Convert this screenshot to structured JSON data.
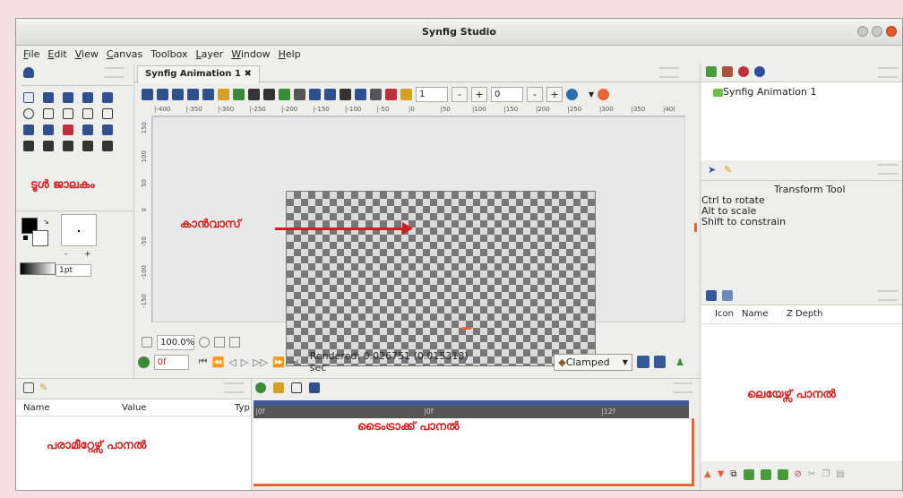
{
  "window": {
    "title": "Synfig Studio"
  },
  "menu": [
    "File",
    "Edit",
    "View",
    "Canvas",
    "Toolbox",
    "Layer",
    "Window",
    "Help"
  ],
  "canvas": {
    "tab_label": "Synfig Animation 1",
    "tab_close": "✖",
    "frame_spin": "1",
    "frame_spin2": "0",
    "ruler_ticks": [
      "-400",
      "-350",
      "-300",
      "-250",
      "-200",
      "-150",
      "-100",
      "-50",
      "0",
      "50",
      "100",
      "150",
      "200",
      "250",
      "300",
      "350",
      "40("
    ],
    "vruler_ticks": [
      "150",
      "100",
      "50",
      "0",
      "-50",
      "-100",
      "-150"
    ],
    "zoom": "100.0%",
    "time_field": "0f",
    "rendered": "Rendered: 0.026751 (0.015318) sec",
    "interpolation": "Clamped"
  },
  "toolbox": {
    "brush_size": "1pt",
    "width_labels": [
      "-",
      "+"
    ]
  },
  "canvas_browser": {
    "item": "Synfig Animation 1"
  },
  "tool_options": {
    "title": "Transform Tool",
    "lines": [
      "Ctrl to rotate",
      "Alt to scale",
      "Shift to constrain"
    ]
  },
  "layers": {
    "columns": [
      "Icon",
      "Name",
      "Z Depth"
    ]
  },
  "params": {
    "columns": [
      "Name",
      "Value",
      "Typ"
    ]
  },
  "timetrack": {
    "marks": [
      "|0f",
      "|12f"
    ]
  },
  "annotations": {
    "tools": "ടൂൾ ജാലകം",
    "canvas": "കാൻവാസ്",
    "layers": "ലെയേഴ്സ് പാനൽ",
    "params": "പരാമീറ്റേഴ്സ് പാനൽ",
    "timetrack": "ടൈംട്രാക്ക് പാനൽ"
  },
  "colors": {
    "accent_red": "#d01e1e",
    "timebar_blue": "#3c5a9a",
    "orange_edge": "#e8633a"
  }
}
